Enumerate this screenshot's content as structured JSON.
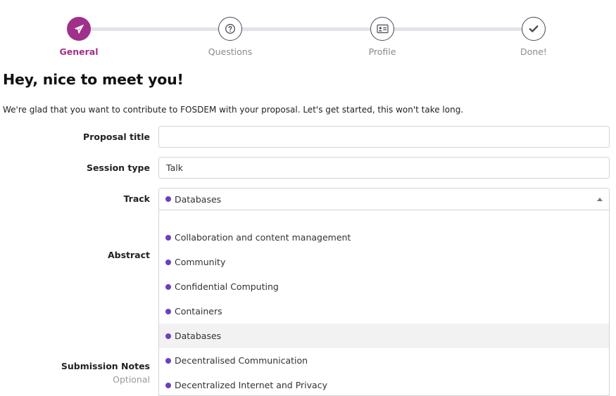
{
  "stepper": {
    "steps": [
      {
        "label": "General",
        "icon": "paper-plane-icon",
        "active": true
      },
      {
        "label": "Questions",
        "icon": "question-icon",
        "active": false
      },
      {
        "label": "Profile",
        "icon": "id-card-icon",
        "active": false
      },
      {
        "label": "Done!",
        "icon": "check-icon",
        "active": false
      }
    ],
    "accent_color": "#a0308a"
  },
  "page": {
    "title": "Hey, nice to meet you!",
    "intro": "We're glad that you want to contribute to FOSDEM with your proposal. Let's get started, this won't take long."
  },
  "form": {
    "proposal_title": {
      "label": "Proposal title",
      "value": ""
    },
    "session_type": {
      "label": "Session type",
      "value": "Talk"
    },
    "track": {
      "label": "Track",
      "selected": "Databases",
      "dot_color": "#6c3fbf",
      "options": [
        "Collaboration and content management",
        "Community",
        "Confidential Computing",
        "Containers",
        "Databases",
        "Decentralised Communication",
        "Decentralized Internet and Privacy"
      ]
    },
    "abstract": {
      "label": "Abstract"
    },
    "submission_notes": {
      "label": "Submission Notes",
      "hint": "Optional"
    }
  }
}
